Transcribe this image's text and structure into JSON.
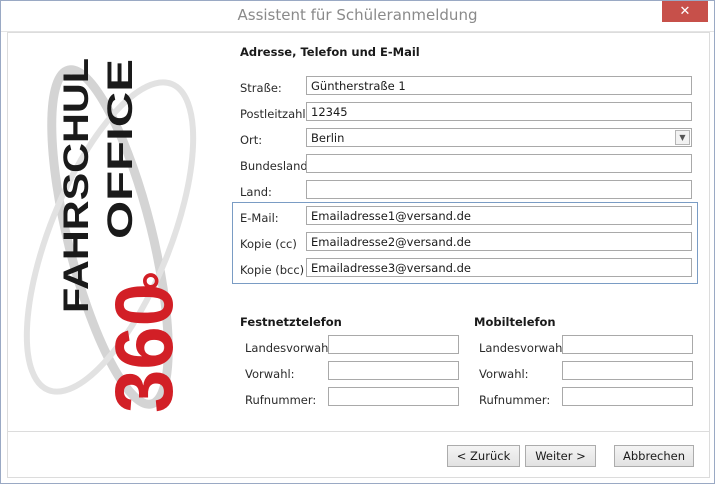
{
  "window": {
    "title": "Assistent für Schüleranmeldung",
    "close_label": "✕"
  },
  "logo": {
    "line1": "FAHRSCHUL",
    "line2": "OFFICE",
    "number": "360",
    "degree": "°"
  },
  "address": {
    "heading": "Adresse, Telefon und E-Mail",
    "street_label": "Straße:",
    "street_value": "Güntherstraße 1",
    "zip_label": "Postleitzahl:",
    "zip_value": "12345",
    "city_label": "Ort:",
    "city_value": "Berlin",
    "state_label": "Bundesland:",
    "state_value": "",
    "country_label": "Land:",
    "country_value": ""
  },
  "email": {
    "email_label": "E-Mail:",
    "email_value": "Emailadresse1@versand.de",
    "cc_label": "Kopie (cc)",
    "cc_value": "Emailadresse2@versand.de",
    "bcc_label": "Kopie (bcc)",
    "bcc_value": "Emailadresse3@versand.de"
  },
  "landline": {
    "heading": "Festnetztelefon",
    "country_code_label": "Landesvorwahl:",
    "country_code_value": "",
    "area_code_label": "Vorwahl:",
    "area_code_value": "",
    "number_label": "Rufnummer:",
    "number_value": ""
  },
  "mobile": {
    "heading": "Mobiltelefon",
    "country_code_label": "Landesvorwahl:",
    "country_code_value": "",
    "area_code_label": "Vorwahl:",
    "area_code_value": "",
    "number_label": "Rufnummer:",
    "number_value": ""
  },
  "buttons": {
    "back": "< Zurück",
    "next": "Weiter >",
    "cancel": "Abbrechen"
  },
  "colors": {
    "logo_red": "#d21f26",
    "logo_black": "#1a1a1a",
    "ring_gray": "#cfcfcf",
    "close_red": "#c7504a"
  }
}
